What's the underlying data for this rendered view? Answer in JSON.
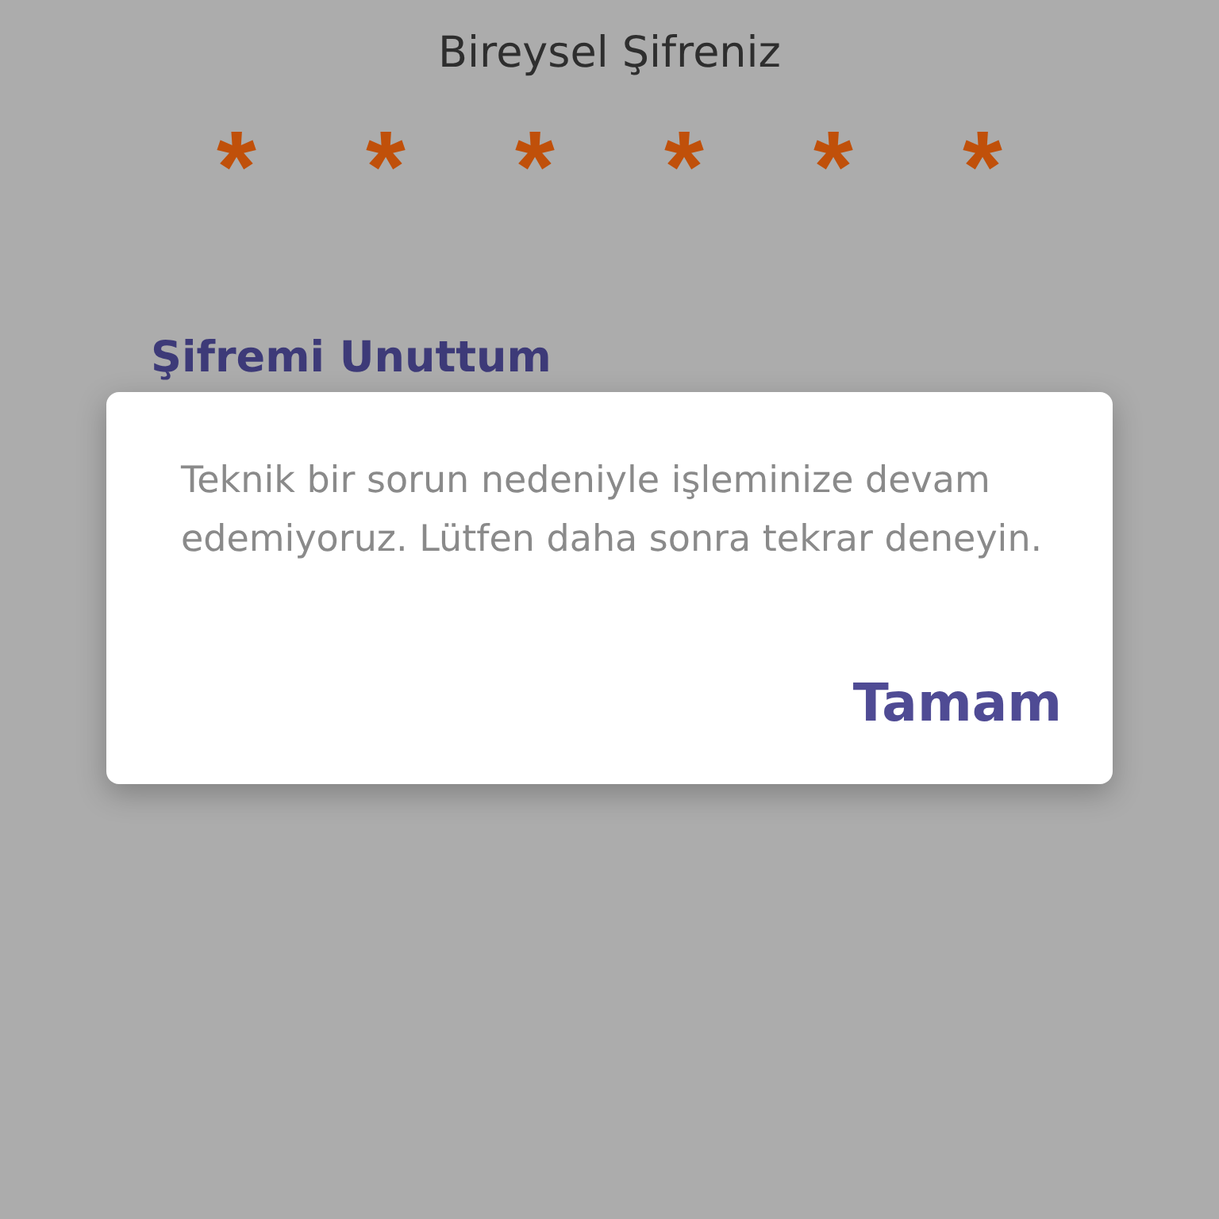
{
  "password_label": "Bireysel Şifreniz",
  "password_mask": [
    "*",
    "*",
    "*",
    "*",
    "*",
    "*"
  ],
  "forgot_password_link": "Şifremi Unuttum",
  "dialog": {
    "message": "Teknik bir sorun nedeniyle işleminize devam edemiyoruz. Lütfen daha sonra tekrar deneyin.",
    "buttons": [
      "Tamam"
    ]
  }
}
